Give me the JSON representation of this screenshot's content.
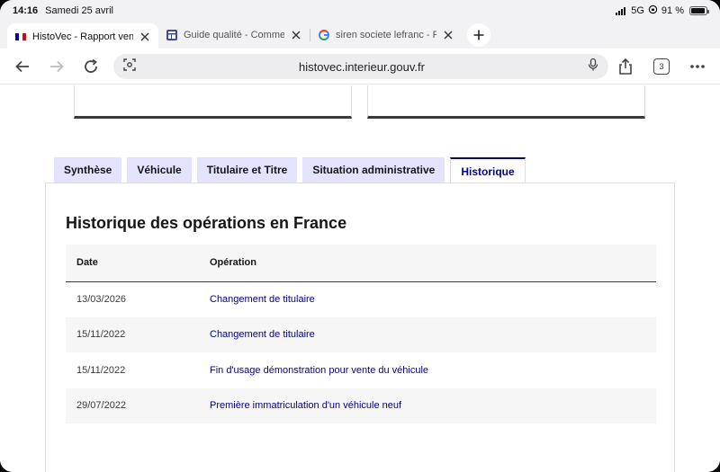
{
  "status": {
    "time": "14:16",
    "date": "Samedi 25 avril",
    "network": "5G",
    "battery": "91 %"
  },
  "tabs": [
    {
      "title": "HistoVec - Rapport vendeur",
      "favicon": "french-flag-icon"
    },
    {
      "title": "Guide qualité - Comment",
      "favicon": "site-icon"
    },
    {
      "title": "siren societe lefranc - Recherche",
      "favicon": "google-icon"
    }
  ],
  "toolbar": {
    "url": "histovec.interieur.gouv.fr",
    "tab_count": "3"
  },
  "page_tabs": [
    "Synthèse",
    "Véhicule",
    "Titulaire et Titre",
    "Situation administrative",
    "Historique"
  ],
  "active_tab_index": 4,
  "section": {
    "title": "Historique des opérations en France",
    "columns": [
      "Date",
      "Opération"
    ],
    "rows": [
      {
        "date": "13/03/2026",
        "operation": "Changement de titulaire"
      },
      {
        "date": "15/11/2022",
        "operation": "Changement de titulaire"
      },
      {
        "date": "15/11/2022",
        "operation": "Fin d'usage démonstration pour vente du véhicule"
      },
      {
        "date": "29/07/2022",
        "operation": "Première immatriculation d'un véhicule neuf"
      }
    ]
  },
  "colors": {
    "accent": "#000091",
    "tab_bg": "#e3e3fd",
    "row_alt": "#f6f6f6"
  }
}
